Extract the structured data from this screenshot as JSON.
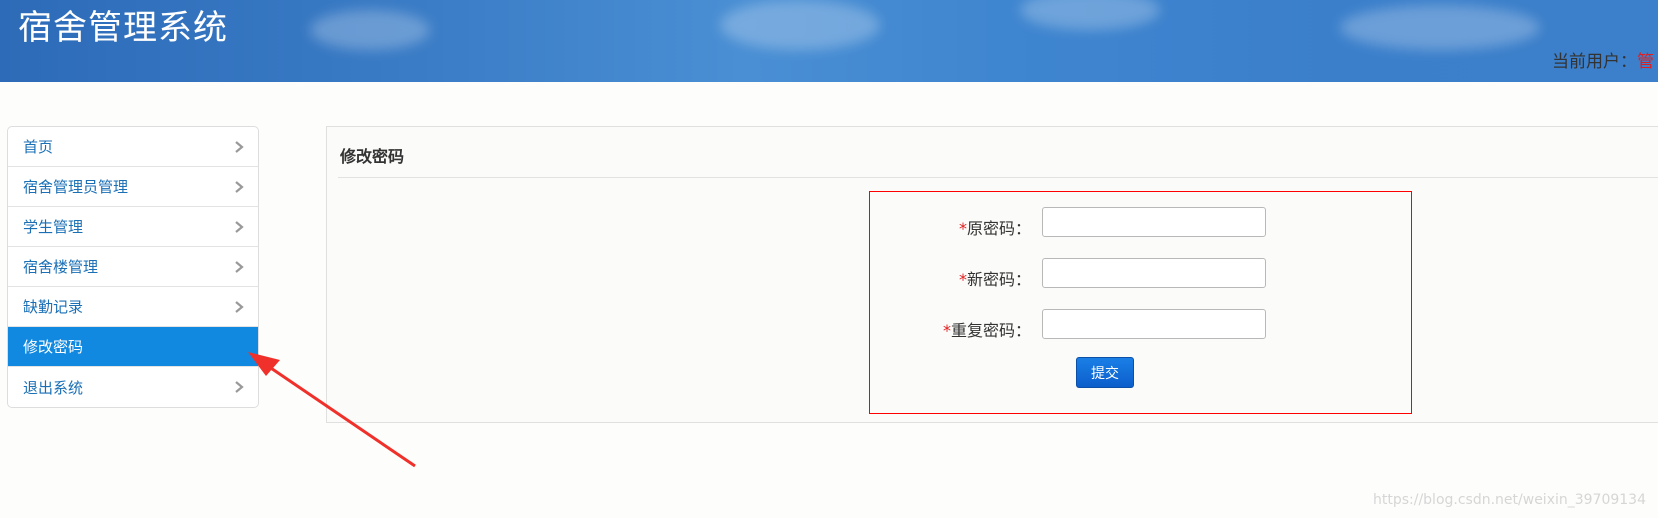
{
  "app": {
    "title": "宿舍管理系统",
    "user_label": "当前用户：",
    "user_name": "管"
  },
  "sidebar": {
    "items": [
      {
        "label": "首页",
        "active": false
      },
      {
        "label": "宿舍管理员管理",
        "active": false
      },
      {
        "label": "学生管理",
        "active": false
      },
      {
        "label": "宿舍楼管理",
        "active": false
      },
      {
        "label": "缺勤记录",
        "active": false
      },
      {
        "label": "修改密码",
        "active": true
      },
      {
        "label": "退出系统",
        "active": false
      }
    ]
  },
  "panel": {
    "title": "修改密码"
  },
  "form": {
    "required_mark": "*",
    "fields": [
      {
        "label": "原密码：",
        "value": ""
      },
      {
        "label": "新密码：",
        "value": ""
      },
      {
        "label": "重复密码：",
        "value": ""
      }
    ],
    "submit_label": "提交"
  },
  "watermark": "https://blog.csdn.net/weixin_39709134",
  "colors": {
    "header": "#3a7cc6",
    "active_nav": "#1289e0",
    "nav_text": "#1a6fb5",
    "required": "#e02020",
    "highlight_box": "#ff0000",
    "button": "#0c5ecb",
    "annotation_arrow": "#f0302a"
  },
  "icons": {
    "nav_chevron": "chevron-right-icon",
    "annotation": "arrow-annotation-icon"
  }
}
